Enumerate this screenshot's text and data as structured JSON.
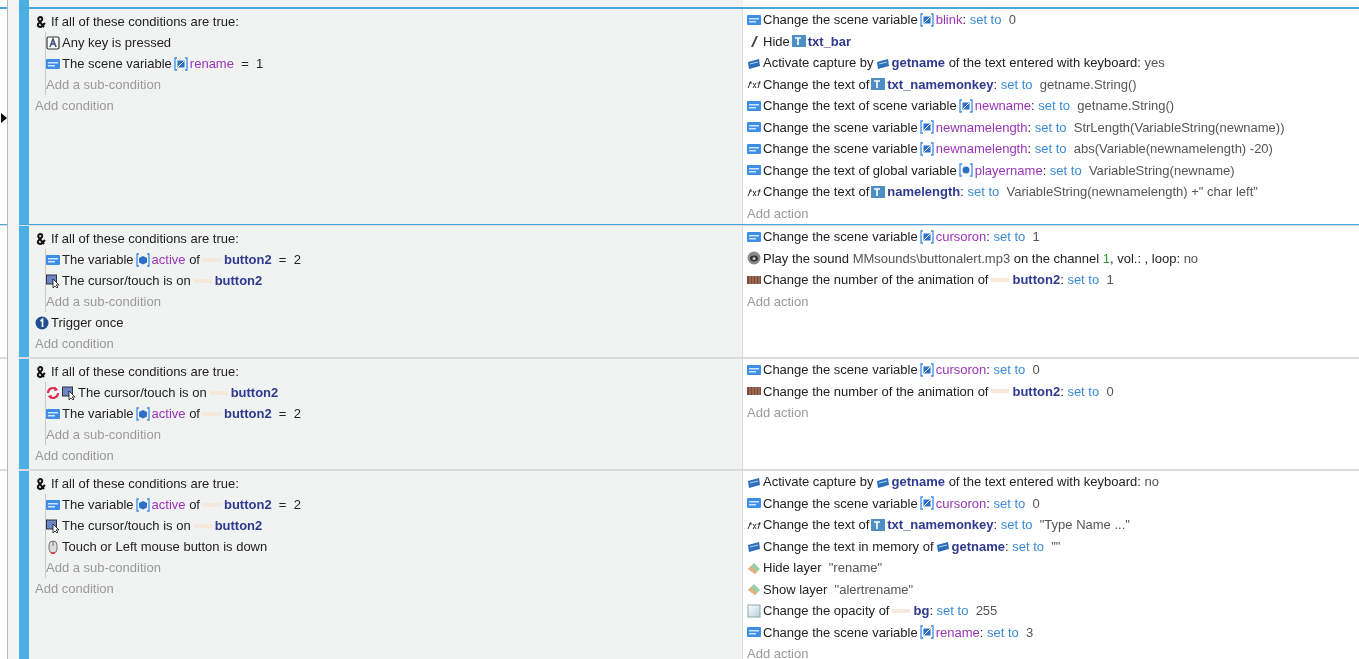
{
  "events": [
    {
      "selected": true,
      "pointer": true,
      "header": "If all of these conditions are true:",
      "sub_conditions": [
        {
          "kind": "key",
          "inverted": false,
          "parts": [
            {
              "kind": "text",
              "runs": [
                {
                  "kind": "plain",
                  "text": "Any key is pressed"
                }
              ]
            }
          ]
        },
        {
          "kind": "variable",
          "inverted": false,
          "parts": [
            {
              "kind": "text",
              "runs": [
                {
                  "kind": "plain",
                  "text": "The scene variable"
                }
              ]
            },
            {
              "kind": "scene-variable"
            },
            {
              "kind": "text",
              "runs": [
                {
                  "kind": "variable",
                  "text": "rename"
                },
                {
                  "kind": "plain",
                  "text": "  =  1"
                }
              ]
            }
          ]
        }
      ],
      "add_sub_condition": "Add a sub-condition",
      "add_condition": "Add condition",
      "actions": [
        {
          "kind": "variable",
          "parts": [
            {
              "kind": "text",
              "runs": [
                {
                  "kind": "plain",
                  "text": "Change the scene variable"
                }
              ]
            },
            {
              "kind": "scene-variable"
            },
            {
              "kind": "text",
              "runs": [
                {
                  "kind": "variable",
                  "text": "blink"
                },
                {
                  "kind": "plain",
                  "text": ": "
                },
                {
                  "kind": "keyword",
                  "text": "set to"
                },
                {
                  "kind": "value",
                  "text": "  0"
                }
              ]
            }
          ]
        },
        {
          "kind": "hide",
          "parts": [
            {
              "kind": "text",
              "runs": [
                {
                  "kind": "plain",
                  "text": "Hide"
                }
              ]
            },
            {
              "kind": "text-object"
            },
            {
              "kind": "text",
              "runs": [
                {
                  "kind": "object",
                  "text": "txt_bar"
                }
              ]
            }
          ]
        },
        {
          "kind": "keyboard",
          "parts": [
            {
              "kind": "text",
              "runs": [
                {
                  "kind": "plain",
                  "text": "Activate capture by"
                }
              ]
            },
            {
              "kind": "keyboard"
            },
            {
              "kind": "text",
              "runs": [
                {
                  "kind": "object",
                  "text": "getname"
                },
                {
                  "kind": "plain",
                  "text": " of the text entered with keyboard: "
                },
                {
                  "kind": "value",
                  "text": "yes"
                }
              ]
            }
          ]
        },
        {
          "kind": "text",
          "parts": [
            {
              "kind": "text",
              "runs": [
                {
                  "kind": "plain",
                  "text": "Change the text of"
                }
              ]
            },
            {
              "kind": "text-object"
            },
            {
              "kind": "text",
              "runs": [
                {
                  "kind": "object",
                  "text": "txt_namemonkey"
                },
                {
                  "kind": "plain",
                  "text": ": "
                },
                {
                  "kind": "keyword",
                  "text": "set to"
                },
                {
                  "kind": "value",
                  "text": "  getname.String()"
                }
              ]
            }
          ]
        },
        {
          "kind": "variable",
          "parts": [
            {
              "kind": "text",
              "runs": [
                {
                  "kind": "plain",
                  "text": "Change the text of scene variable"
                }
              ]
            },
            {
              "kind": "scene-variable"
            },
            {
              "kind": "text",
              "runs": [
                {
                  "kind": "variable",
                  "text": "newname"
                },
                {
                  "kind": "plain",
                  "text": ": "
                },
                {
                  "kind": "keyword",
                  "text": "set to"
                },
                {
                  "kind": "value",
                  "text": "  getname.String()"
                }
              ]
            }
          ]
        },
        {
          "kind": "variable",
          "parts": [
            {
              "kind": "text",
              "runs": [
                {
                  "kind": "plain",
                  "text": "Change the scene variable"
                }
              ]
            },
            {
              "kind": "scene-variable"
            },
            {
              "kind": "text",
              "runs": [
                {
                  "kind": "variable",
                  "text": "newnamelength"
                },
                {
                  "kind": "plain",
                  "text": ": "
                },
                {
                  "kind": "keyword",
                  "text": "set to"
                },
                {
                  "kind": "value",
                  "text": "  StrLength(VariableString(newname))"
                }
              ]
            }
          ]
        },
        {
          "kind": "variable",
          "parts": [
            {
              "kind": "text",
              "runs": [
                {
                  "kind": "plain",
                  "text": "Change the scene variable"
                }
              ]
            },
            {
              "kind": "scene-variable"
            },
            {
              "kind": "text",
              "runs": [
                {
                  "kind": "variable",
                  "text": "newnamelength"
                },
                {
                  "kind": "plain",
                  "text": ": "
                },
                {
                  "kind": "keyword",
                  "text": "set to"
                },
                {
                  "kind": "value",
                  "text": "  abs(Variable(newnamelength) -20)"
                }
              ]
            }
          ]
        },
        {
          "kind": "variable",
          "parts": [
            {
              "kind": "text",
              "runs": [
                {
                  "kind": "plain",
                  "text": "Change the text of global variable"
                }
              ]
            },
            {
              "kind": "global-variable"
            },
            {
              "kind": "text",
              "runs": [
                {
                  "kind": "variable",
                  "text": "playername"
                },
                {
                  "kind": "plain",
                  "text": ": "
                },
                {
                  "kind": "keyword",
                  "text": "set to"
                },
                {
                  "kind": "value",
                  "text": "  VariableString(newname)"
                }
              ]
            }
          ]
        },
        {
          "kind": "text",
          "parts": [
            {
              "kind": "text",
              "runs": [
                {
                  "kind": "plain",
                  "text": "Change the text of"
                }
              ]
            },
            {
              "kind": "text-object"
            },
            {
              "kind": "text",
              "runs": [
                {
                  "kind": "object",
                  "text": "namelength"
                },
                {
                  "kind": "plain",
                  "text": ": "
                },
                {
                  "kind": "keyword",
                  "text": "set to"
                },
                {
                  "kind": "value",
                  "text": "  VariableString(newnamelength) +\" char left\""
                }
              ]
            }
          ]
        }
      ],
      "add_action": "Add action"
    },
    {
      "selected": false,
      "pointer": false,
      "header": "If all of these conditions are true:",
      "sub_conditions": [
        {
          "kind": "variable",
          "inverted": false,
          "parts": [
            {
              "kind": "text",
              "runs": [
                {
                  "kind": "plain",
                  "text": "The variable"
                }
              ]
            },
            {
              "kind": "object-variable"
            },
            {
              "kind": "text",
              "runs": [
                {
                  "kind": "variable",
                  "text": "active"
                },
                {
                  "kind": "plain",
                  "text": " of"
                }
              ]
            },
            {
              "kind": "sprite"
            },
            {
              "kind": "text",
              "runs": [
                {
                  "kind": "object",
                  "text": "button2"
                },
                {
                  "kind": "plain",
                  "text": "  =  2"
                }
              ]
            }
          ]
        },
        {
          "kind": "cursor",
          "inverted": false,
          "parts": [
            {
              "kind": "text",
              "runs": [
                {
                  "kind": "plain",
                  "text": "The cursor/touch is on"
                }
              ]
            },
            {
              "kind": "sprite"
            },
            {
              "kind": "text",
              "runs": [
                {
                  "kind": "object",
                  "text": "button2"
                }
              ]
            }
          ]
        }
      ],
      "add_sub_condition": "Add a sub-condition",
      "conditions": [
        {
          "kind": "trigger",
          "inverted": false,
          "parts": [
            {
              "kind": "text",
              "runs": [
                {
                  "kind": "plain",
                  "text": "Trigger once"
                }
              ]
            }
          ]
        }
      ],
      "add_condition": "Add condition",
      "actions": [
        {
          "kind": "variable",
          "parts": [
            {
              "kind": "text",
              "runs": [
                {
                  "kind": "plain",
                  "text": "Change the scene variable"
                }
              ]
            },
            {
              "kind": "scene-variable"
            },
            {
              "kind": "text",
              "runs": [
                {
                  "kind": "variable",
                  "text": "cursoron"
                },
                {
                  "kind": "plain",
                  "text": ": "
                },
                {
                  "kind": "keyword",
                  "text": "set to"
                },
                {
                  "kind": "value",
                  "text": "  1"
                }
              ]
            }
          ]
        },
        {
          "kind": "sound",
          "parts": [
            {
              "kind": "text",
              "runs": [
                {
                  "kind": "plain",
                  "text": "Play the sound "
                },
                {
                  "kind": "value",
                  "text": "MMsounds\\buttonalert.mp3"
                },
                {
                  "kind": "plain",
                  "text": " on the channel "
                },
                {
                  "kind": "number",
                  "text": "1"
                },
                {
                  "kind": "plain",
                  "text": ", vol.: , loop: "
                },
                {
                  "kind": "value",
                  "text": "no"
                }
              ]
            }
          ]
        },
        {
          "kind": "animation",
          "parts": [
            {
              "kind": "text",
              "runs": [
                {
                  "kind": "plain",
                  "text": "Change the number of the animation of"
                }
              ]
            },
            {
              "kind": "sprite"
            },
            {
              "kind": "text",
              "runs": [
                {
                  "kind": "object",
                  "text": "button2"
                },
                {
                  "kind": "plain",
                  "text": ": "
                },
                {
                  "kind": "keyword",
                  "text": "set to"
                },
                {
                  "kind": "value",
                  "text": "  1"
                }
              ]
            }
          ]
        }
      ],
      "add_action": "Add action"
    },
    {
      "selected": false,
      "pointer": false,
      "header": "If all of these conditions are true:",
      "sub_conditions": [
        {
          "kind": "cursor",
          "inverted": true,
          "parts": [
            {
              "kind": "text",
              "runs": [
                {
                  "kind": "plain",
                  "text": "The cursor/touch is on"
                }
              ]
            },
            {
              "kind": "sprite"
            },
            {
              "kind": "text",
              "runs": [
                {
                  "kind": "object",
                  "text": "button2"
                }
              ]
            }
          ]
        },
        {
          "kind": "variable",
          "inverted": false,
          "parts": [
            {
              "kind": "text",
              "runs": [
                {
                  "kind": "plain",
                  "text": "The variable"
                }
              ]
            },
            {
              "kind": "object-variable"
            },
            {
              "kind": "text",
              "runs": [
                {
                  "kind": "variable",
                  "text": "active"
                },
                {
                  "kind": "plain",
                  "text": " of"
                }
              ]
            },
            {
              "kind": "sprite"
            },
            {
              "kind": "text",
              "runs": [
                {
                  "kind": "object",
                  "text": "button2"
                },
                {
                  "kind": "plain",
                  "text": "  =  2"
                }
              ]
            }
          ]
        }
      ],
      "add_sub_condition": "Add a sub-condition",
      "add_condition": "Add condition",
      "actions": [
        {
          "kind": "variable",
          "parts": [
            {
              "kind": "text",
              "runs": [
                {
                  "kind": "plain",
                  "text": "Change the scene variable"
                }
              ]
            },
            {
              "kind": "scene-variable"
            },
            {
              "kind": "text",
              "runs": [
                {
                  "kind": "variable",
                  "text": "cursoron"
                },
                {
                  "kind": "plain",
                  "text": ": "
                },
                {
                  "kind": "keyword",
                  "text": "set to"
                },
                {
                  "kind": "value",
                  "text": "  0"
                }
              ]
            }
          ]
        },
        {
          "kind": "animation",
          "parts": [
            {
              "kind": "text",
              "runs": [
                {
                  "kind": "plain",
                  "text": "Change the number of the animation of"
                }
              ]
            },
            {
              "kind": "sprite"
            },
            {
              "kind": "text",
              "runs": [
                {
                  "kind": "object",
                  "text": "button2"
                },
                {
                  "kind": "plain",
                  "text": ": "
                },
                {
                  "kind": "keyword",
                  "text": "set to"
                },
                {
                  "kind": "value",
                  "text": "  0"
                }
              ]
            }
          ]
        }
      ],
      "add_action": "Add action"
    },
    {
      "selected": false,
      "pointer": false,
      "header": "If all of these conditions are true:",
      "sub_conditions": [
        {
          "kind": "variable",
          "inverted": false,
          "parts": [
            {
              "kind": "text",
              "runs": [
                {
                  "kind": "plain",
                  "text": "The variable"
                }
              ]
            },
            {
              "kind": "object-variable"
            },
            {
              "kind": "text",
              "runs": [
                {
                  "kind": "variable",
                  "text": "active"
                },
                {
                  "kind": "plain",
                  "text": " of"
                }
              ]
            },
            {
              "kind": "sprite"
            },
            {
              "kind": "text",
              "runs": [
                {
                  "kind": "object",
                  "text": "button2"
                },
                {
                  "kind": "plain",
                  "text": "  =  2"
                }
              ]
            }
          ]
        },
        {
          "kind": "cursor",
          "inverted": false,
          "parts": [
            {
              "kind": "text",
              "runs": [
                {
                  "kind": "plain",
                  "text": "The cursor/touch is on"
                }
              ]
            },
            {
              "kind": "sprite"
            },
            {
              "kind": "text",
              "runs": [
                {
                  "kind": "object",
                  "text": "button2"
                }
              ]
            }
          ]
        },
        {
          "kind": "mouse",
          "inverted": false,
          "parts": [
            {
              "kind": "text",
              "runs": [
                {
                  "kind": "plain",
                  "text": "Touch or Left mouse button is down"
                }
              ]
            }
          ]
        }
      ],
      "add_sub_condition": "Add a sub-condition",
      "add_condition": "Add condition",
      "actions": [
        {
          "kind": "keyboard",
          "parts": [
            {
              "kind": "text",
              "runs": [
                {
                  "kind": "plain",
                  "text": "Activate capture by"
                }
              ]
            },
            {
              "kind": "keyboard"
            },
            {
              "kind": "text",
              "runs": [
                {
                  "kind": "object",
                  "text": "getname"
                },
                {
                  "kind": "plain",
                  "text": " of the text entered with keyboard: "
                },
                {
                  "kind": "value",
                  "text": "no"
                }
              ]
            }
          ]
        },
        {
          "kind": "variable",
          "parts": [
            {
              "kind": "text",
              "runs": [
                {
                  "kind": "plain",
                  "text": "Change the scene variable"
                }
              ]
            },
            {
              "kind": "scene-variable"
            },
            {
              "kind": "text",
              "runs": [
                {
                  "kind": "variable",
                  "text": "cursoron"
                },
                {
                  "kind": "plain",
                  "text": ": "
                },
                {
                  "kind": "keyword",
                  "text": "set to"
                },
                {
                  "kind": "value",
                  "text": "  0"
                }
              ]
            }
          ]
        },
        {
          "kind": "text",
          "parts": [
            {
              "kind": "text",
              "runs": [
                {
                  "kind": "plain",
                  "text": "Change the text of"
                }
              ]
            },
            {
              "kind": "text-object"
            },
            {
              "kind": "text",
              "runs": [
                {
                  "kind": "object",
                  "text": "txt_namemonkey"
                },
                {
                  "kind": "plain",
                  "text": ": "
                },
                {
                  "kind": "keyword",
                  "text": "set to"
                },
                {
                  "kind": "value",
                  "text": "  \"Type Name ...\""
                }
              ]
            }
          ]
        },
        {
          "kind": "keyboard",
          "parts": [
            {
              "kind": "text",
              "runs": [
                {
                  "kind": "plain",
                  "text": "Change the text in memory of"
                }
              ]
            },
            {
              "kind": "keyboard"
            },
            {
              "kind": "text",
              "runs": [
                {
                  "kind": "object",
                  "text": "getname"
                },
                {
                  "kind": "plain",
                  "text": ": "
                },
                {
                  "kind": "keyword",
                  "text": "set to"
                },
                {
                  "kind": "value",
                  "text": "  \"\""
                }
              ]
            }
          ]
        },
        {
          "kind": "layer",
          "parts": [
            {
              "kind": "text",
              "runs": [
                {
                  "kind": "plain",
                  "text": "Hide layer  "
                },
                {
                  "kind": "value",
                  "text": "\"rename\""
                }
              ]
            }
          ]
        },
        {
          "kind": "layer",
          "parts": [
            {
              "kind": "text",
              "runs": [
                {
                  "kind": "plain",
                  "text": "Show layer  "
                },
                {
                  "kind": "value",
                  "text": "\"alertrename\""
                }
              ]
            }
          ]
        },
        {
          "kind": "opacity",
          "parts": [
            {
              "kind": "text",
              "runs": [
                {
                  "kind": "plain",
                  "text": "Change the opacity of"
                }
              ]
            },
            {
              "kind": "sprite"
            },
            {
              "kind": "text",
              "runs": [
                {
                  "kind": "object",
                  "text": "bg"
                },
                {
                  "kind": "plain",
                  "text": ": "
                },
                {
                  "kind": "keyword",
                  "text": "set to"
                },
                {
                  "kind": "value",
                  "text": "  255"
                }
              ]
            }
          ]
        },
        {
          "kind": "variable",
          "parts": [
            {
              "kind": "text",
              "runs": [
                {
                  "kind": "plain",
                  "text": "Change the scene variable"
                }
              ]
            },
            {
              "kind": "scene-variable"
            },
            {
              "kind": "text",
              "runs": [
                {
                  "kind": "variable",
                  "text": "rename"
                },
                {
                  "kind": "plain",
                  "text": ": "
                },
                {
                  "kind": "keyword",
                  "text": "set to"
                },
                {
                  "kind": "value",
                  "text": "  3"
                }
              ]
            }
          ]
        }
      ],
      "add_action": "Add action"
    }
  ]
}
